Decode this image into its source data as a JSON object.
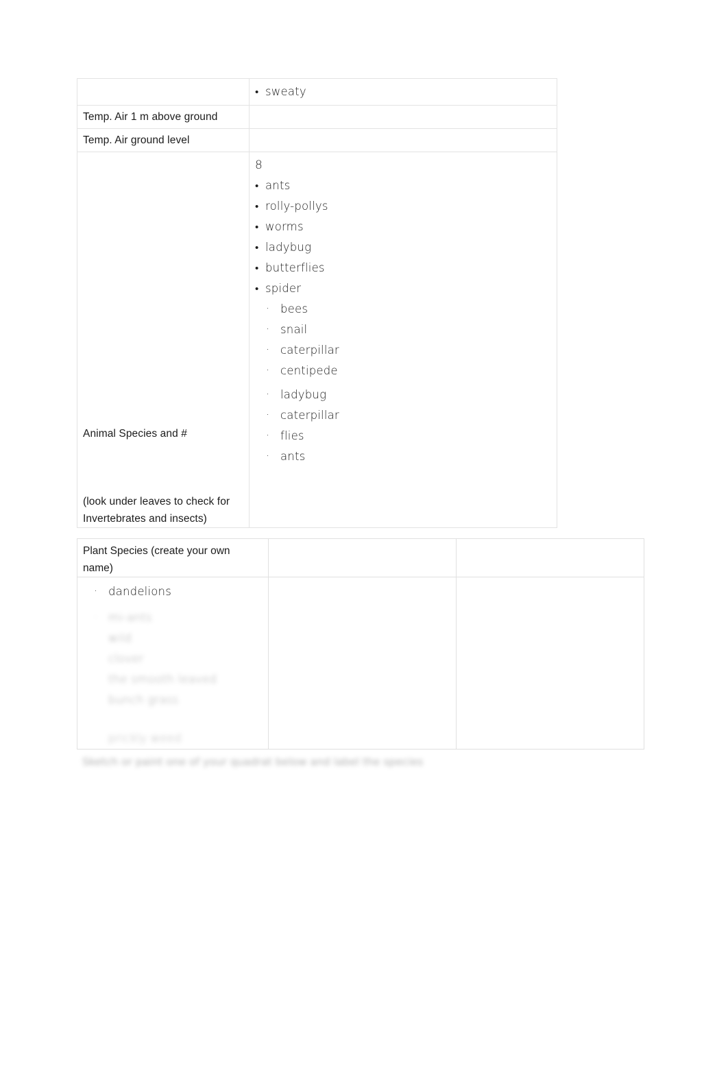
{
  "document": {
    "type": "worksheet-table",
    "page_background": "#ffffff",
    "border_color": "#e3e3e3"
  },
  "top_table": {
    "rows": [
      {
        "label": "",
        "value_kind": "bullets",
        "bullets": [
          "sweaty"
        ]
      },
      {
        "label": "Temp. Air 1 m above ground",
        "value_kind": "empty",
        "bullets": []
      },
      {
        "label": "Temp. Air ground level",
        "value_kind": "empty",
        "bullets": []
      },
      {
        "label_line_1": "Animal Species and #",
        "label_line_2": "(look under leaves to check for Invertebrates and insects)",
        "value_kind": "mixed",
        "count": "8",
        "bullets": [
          "ants",
          "rolly-pollys",
          "worms",
          "ladybug",
          "butterflies",
          "spider"
        ],
        "sub_bullets_group_1": [
          "bees",
          "snail",
          "caterpillar",
          "centipede"
        ],
        "sub_bullets_group_2": [
          "ladybug",
          "caterpillar",
          "flies",
          "ants"
        ]
      }
    ],
    "labels": {
      "temp_air_1m": "Temp. Air 1 m above ground",
      "temp_air_ground": "Temp. Air ground level",
      "animal_species": "Animal Species and #",
      "animal_species_note": "(look under leaves to check for Invertebrates and insects)"
    }
  },
  "bottom_table": {
    "header_cell_1": "Plant Species (create your own name)",
    "header_cell_2": "",
    "header_cell_3": "",
    "plant_bullets_visible": [
      "dandelions"
    ],
    "plant_bullets_redacted": [
      "redacted-line-1",
      "redacted-line-2",
      "redacted-line-3",
      "redacted-line-4",
      "redacted-line-5",
      "redacted-line-6",
      "redacted-line-7"
    ]
  },
  "footer": {
    "redacted_caption": "illegible blurred handwriting line"
  }
}
